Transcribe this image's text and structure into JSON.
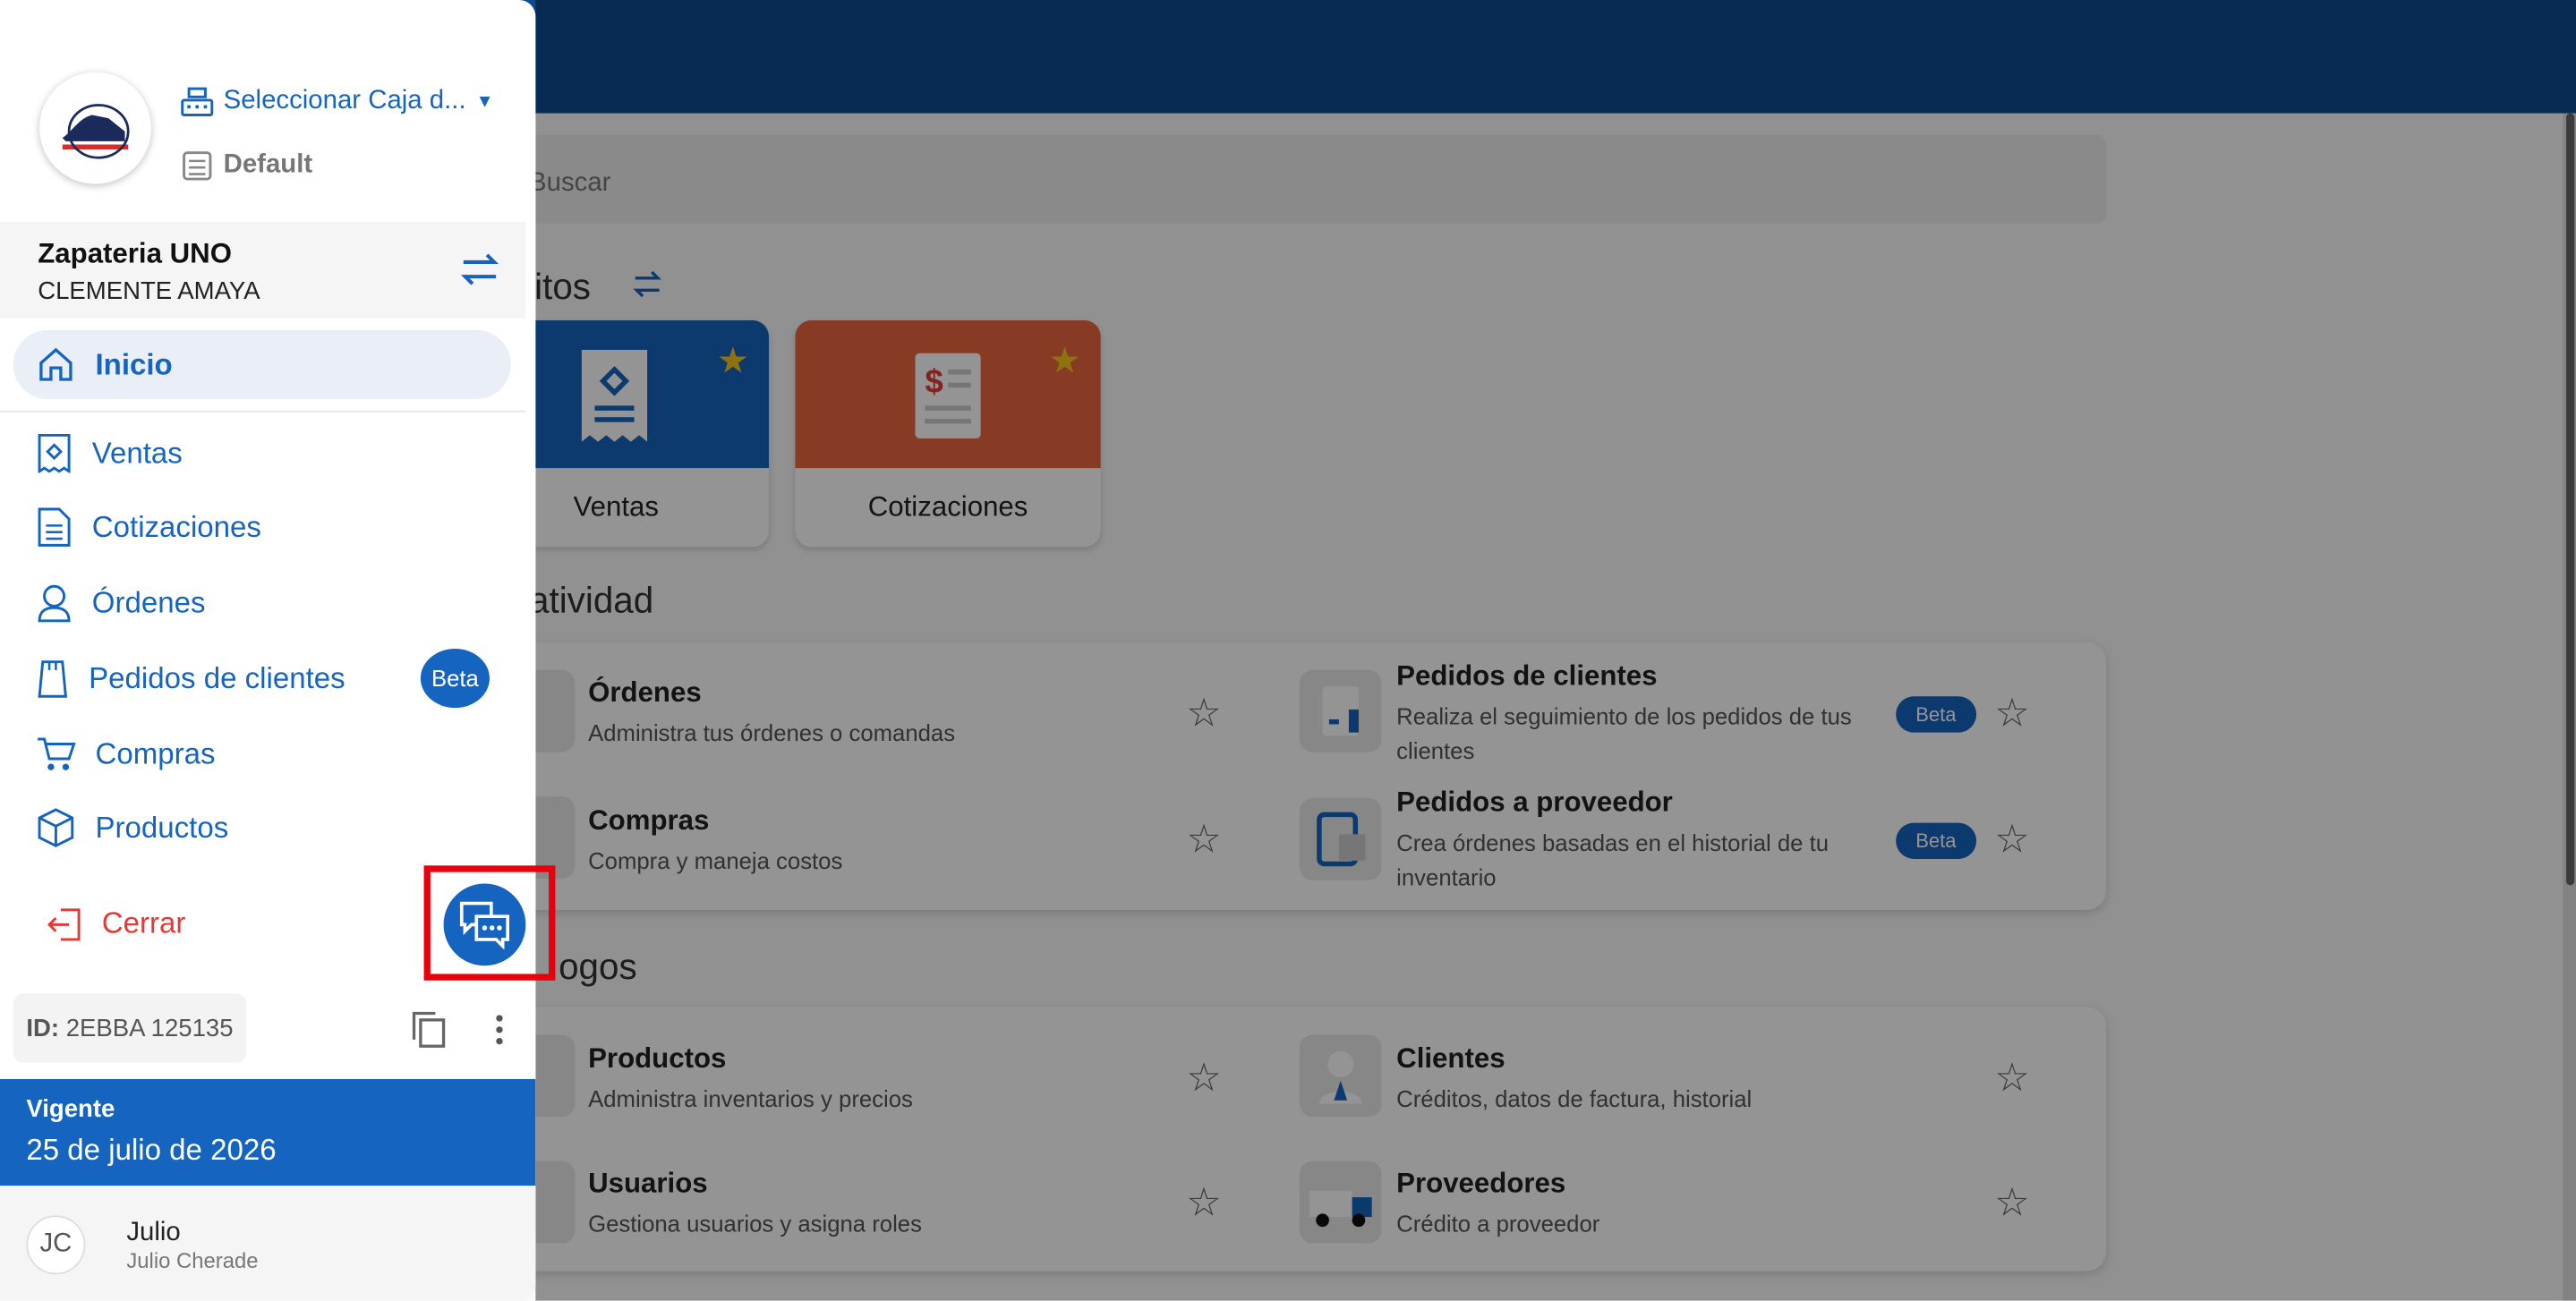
{
  "main": {
    "search_placeholder": "Buscar",
    "favorites_title": "ritos",
    "favorites": [
      {
        "label": "Ventas"
      },
      {
        "label": "Cotizaciones"
      }
    ],
    "productivity_title": "atividad",
    "productivity": [
      {
        "title": "Órdenes",
        "desc": "Administra tus órdenes o comandas"
      },
      {
        "title": "Compras",
        "desc": "Compra y maneja costos"
      },
      {
        "title": "Pedidos de clientes",
        "desc": "Realiza el seguimiento de los pedidos de tus clientes",
        "badge": "Beta"
      },
      {
        "title": "Pedidos a proveedor",
        "desc": "Crea órdenes basadas en el historial de tu inventario",
        "badge": "Beta"
      }
    ],
    "catalogs_title": "ogos",
    "catalogs": [
      {
        "title": "Productos",
        "desc": "Administra inventarios y precios"
      },
      {
        "title": "Usuarios",
        "desc": "Gestiona usuarios y asigna roles"
      },
      {
        "title": "Clientes",
        "desc": "Créditos, datos de factura, historial"
      },
      {
        "title": "Proveedores",
        "desc": "Crédito a proveedor"
      }
    ]
  },
  "drawer": {
    "caja_label": "Seleccionar Caja d...",
    "warehouse": "Default",
    "business": "Zapateria UNO",
    "user_name": "CLEMENTE AMAYA",
    "nav": [
      {
        "label": "Inicio",
        "icon": "home-icon"
      },
      {
        "label": "Ventas",
        "icon": "receipt-icon"
      },
      {
        "label": "Cotizaciones",
        "icon": "document-icon"
      },
      {
        "label": "Órdenes",
        "icon": "waiter-icon"
      },
      {
        "label": "Pedidos de clientes",
        "icon": "bag-icon"
      },
      {
        "label": "Compras",
        "icon": "cart-icon"
      },
      {
        "label": "Productos",
        "icon": "box-icon"
      }
    ],
    "nav_badge": "Beta",
    "logout": "Cerrar",
    "id_label": "ID:",
    "id_value": "2EBBA 125135",
    "license_status": "Vigente",
    "license_date": "25 de julio de 2026",
    "avatar": "JC",
    "profile_name": "Julio",
    "profile_sub": "Julio Cherade"
  },
  "colors": {
    "primary": "#1565c0",
    "topbar": "#0d4a8f",
    "danger": "#e53935",
    "highlight": "#e8000d",
    "cotizaciones": "#e8643f"
  }
}
